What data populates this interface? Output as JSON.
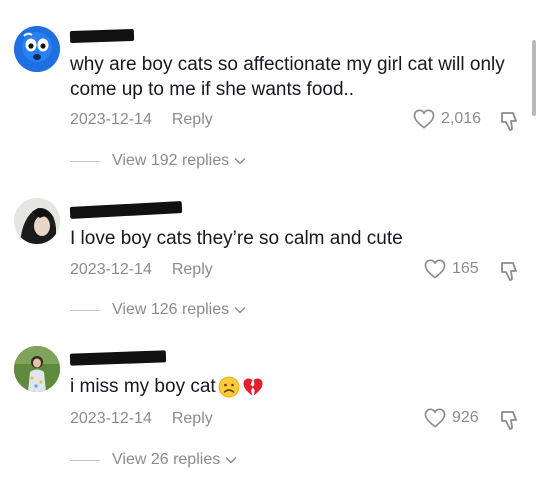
{
  "comments": [
    {
      "text": "why are boy cats so affectionate my girl cat will only come up to me if she wants food..",
      "date": "2023-12-14",
      "reply_label": "Reply",
      "likes": "2,016",
      "view_replies": "View 192 replies"
    },
    {
      "text": "I love boy cats they’re so calm and cute",
      "date": "2023-12-14",
      "reply_label": "Reply",
      "likes": "165",
      "view_replies": "View 126 replies"
    },
    {
      "text": "i miss my boy cat",
      "date": "2023-12-14",
      "reply_label": "Reply",
      "likes": "926",
      "view_replies": "View 26 replies"
    }
  ],
  "icons": {
    "like": "heart-outline-icon",
    "dislike": "thumbs-down-outline-icon",
    "expand": "chevron-down-icon",
    "emoji_1": "worried-face-emoji",
    "emoji_2": "broken-heart-emoji"
  },
  "colors": {
    "text": "#161823",
    "secondary": "#8a8b91",
    "redaction": "#111111"
  }
}
